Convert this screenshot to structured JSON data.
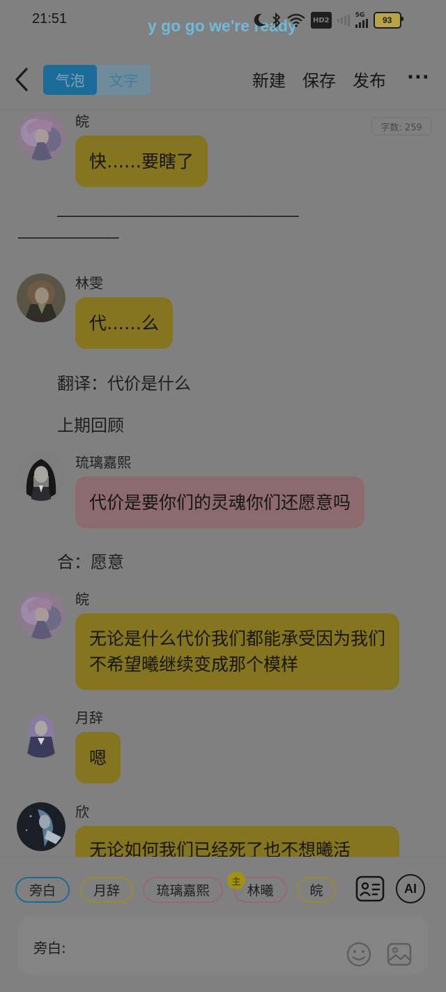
{
  "status_bar": {
    "time": "21:51",
    "lyric": "y go go we're ready",
    "network_badge": "HD2",
    "network_type": "5G",
    "battery": "93"
  },
  "header": {
    "mode_tabs": [
      "气泡",
      "文字"
    ],
    "active_mode": "气泡",
    "actions": [
      "新建",
      "保存",
      "发布"
    ],
    "more": "···"
  },
  "chat": {
    "word_count": "字数: 259",
    "messages": [
      {
        "name": "皖",
        "text": "快……要瞎了",
        "color": "yellow"
      },
      {
        "name": "林雯",
        "text": "代……么",
        "color": "yellow"
      },
      {
        "name": "琉璃嘉熙",
        "text": "代价是要你们的灵魂你们还愿意吗",
        "color": "pink"
      },
      {
        "name": "皖",
        "text": "无论是什么代价我们都能承受因为我们不希望曦继续变成那个模样",
        "color": "yellow"
      },
      {
        "name": "月辞",
        "text": "嗯",
        "color": "yellow"
      },
      {
        "name": "欣",
        "text": "无论如何我们已经死了也不想曦活",
        "color": "yellow"
      }
    ],
    "dash_line_1": "————————————————————————",
    "dash_line_2": "——————————",
    "narrations": [
      "翻译：代价是什么",
      "上期回顾",
      "合：愿意"
    ]
  },
  "bottom": {
    "characters": [
      {
        "label": "旁白",
        "border": "#1c6c9a",
        "selected": true
      },
      {
        "label": "月辞",
        "border": "#9a8a2a"
      },
      {
        "label": "琉璃嘉熙",
        "border": "#956a70"
      },
      {
        "label": "林曦",
        "border": "#956a70",
        "host": true
      },
      {
        "label": "皖",
        "border": "#9a8a2a"
      }
    ],
    "host_badge": "主",
    "ai_label": "AI",
    "input_label": "旁白:"
  },
  "colors": {
    "background": "#808080",
    "accent_blue": "#1c6c9a",
    "bubble_yellow": "#857420",
    "bubble_pink": "#8c6a6e"
  },
  "icons": [
    "back-arrow-icon",
    "moon-icon",
    "bluetooth-icon",
    "wifi-icon",
    "contact-card-icon",
    "emoji-icon",
    "image-icon"
  ]
}
